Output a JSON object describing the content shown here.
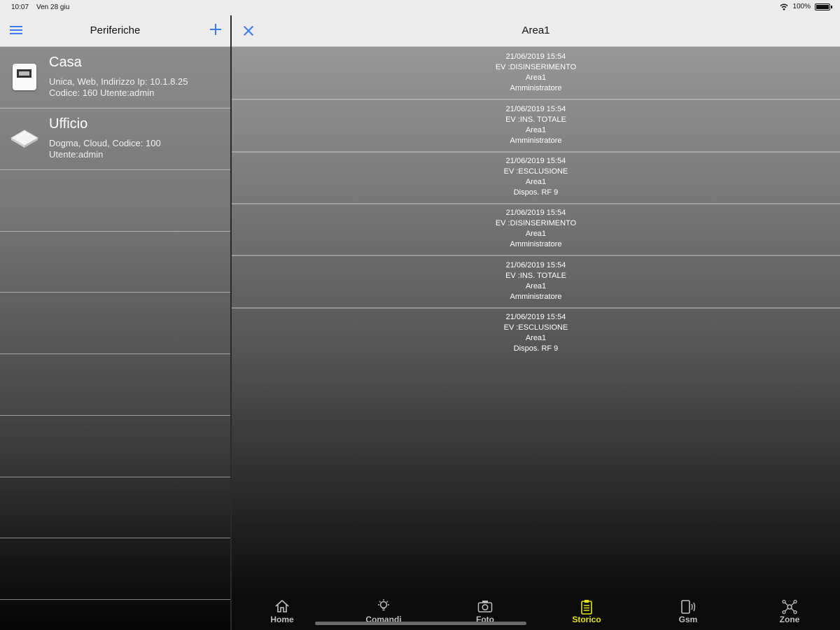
{
  "status_bar": {
    "time": "10:07",
    "date": "Ven 28 giu",
    "battery": "100%"
  },
  "left": {
    "title": "Periferiche",
    "devices": [
      {
        "name": "Casa",
        "line1": "Unica, Web, Indirizzo Ip: 10.1.8.25",
        "line2": "Codice: 160 Utente:admin",
        "icon": "panel-icon"
      },
      {
        "name": "Ufficio",
        "line1": "Dogma, Cloud, Codice: 100",
        "line2": "Utente:admin",
        "icon": "router-icon"
      }
    ]
  },
  "right": {
    "title": "Area1",
    "events": [
      {
        "date": "21/06/2019 15:54",
        "event": "EV :DISINSERIMENTO",
        "area": "Area1",
        "user": "Amministratore"
      },
      {
        "date": "21/06/2019 15:54",
        "event": "EV :INS. TOTALE",
        "area": "Area1",
        "user": "Amministratore"
      },
      {
        "date": "21/06/2019 15:54",
        "event": "EV :ESCLUSIONE",
        "area": "Area1",
        "user": "Dispos. RF 9"
      },
      {
        "date": "21/06/2019 15:54",
        "event": "EV :DISINSERIMENTO",
        "area": "Area1",
        "user": "Amministratore"
      },
      {
        "date": "21/06/2019 15:54",
        "event": "EV :INS. TOTALE",
        "area": "Area1",
        "user": "Amministratore"
      },
      {
        "date": "21/06/2019 15:54",
        "event": "EV :ESCLUSIONE",
        "area": "Area1",
        "user": "Dispos. RF 9"
      }
    ]
  },
  "tabs": [
    {
      "label": "Home",
      "icon": "home-icon",
      "active": false
    },
    {
      "label": "Comandi",
      "icon": "lightbulb-icon",
      "active": false
    },
    {
      "label": "Foto",
      "icon": "camera-icon",
      "active": false
    },
    {
      "label": "Storico",
      "icon": "clipboard-icon",
      "active": true
    },
    {
      "label": "Gsm",
      "icon": "phone-signal-icon",
      "active": false
    },
    {
      "label": "Zone",
      "icon": "zones-icon",
      "active": false
    }
  ],
  "colors": {
    "accent_blue": "#3b7cf5",
    "active_tab": "#e5e500",
    "header_bg": "#ececec"
  }
}
